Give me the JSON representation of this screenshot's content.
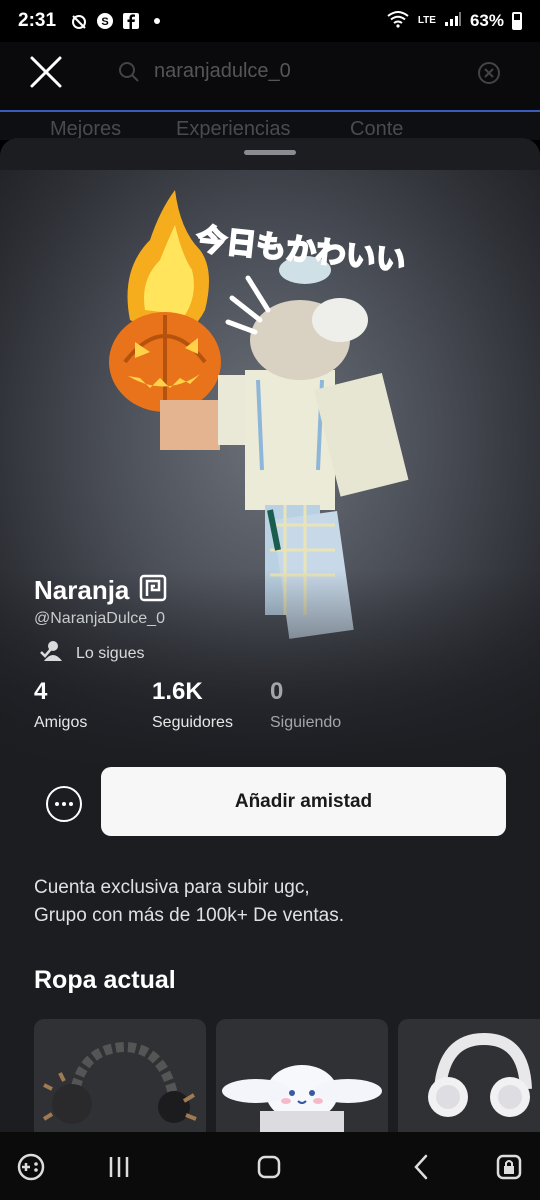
{
  "status_bar": {
    "time": "2:31",
    "network_label": "LTE",
    "battery_percent": "63%",
    "battery_level": 0.63
  },
  "background": {
    "search_text": "naranjadulce_0",
    "tabs": [
      "Mejores",
      "Experiencias",
      "Conte"
    ]
  },
  "profile": {
    "display_name": "Naranja",
    "username": "@NaranjaDulce_0",
    "following_label": "Lo sigues",
    "avatar_caption": "今日もかわいい",
    "stats": [
      {
        "value": "4",
        "label": "Amigos"
      },
      {
        "value": "1.6K",
        "label": "Seguidores"
      },
      {
        "value": "0",
        "label": "Siguiendo"
      }
    ],
    "add_friend_label": "Añadir amistad",
    "bio_lines": [
      "Cuenta exclusiva para subir ugc,",
      "Grupo con más de 100k+ De ventas."
    ],
    "outfit_title": "Ropa actual"
  },
  "colors": {
    "sheet_bg": "#1c1d21",
    "button_bg": "#f7f7f8",
    "accent_line": "#3b5bbf"
  }
}
